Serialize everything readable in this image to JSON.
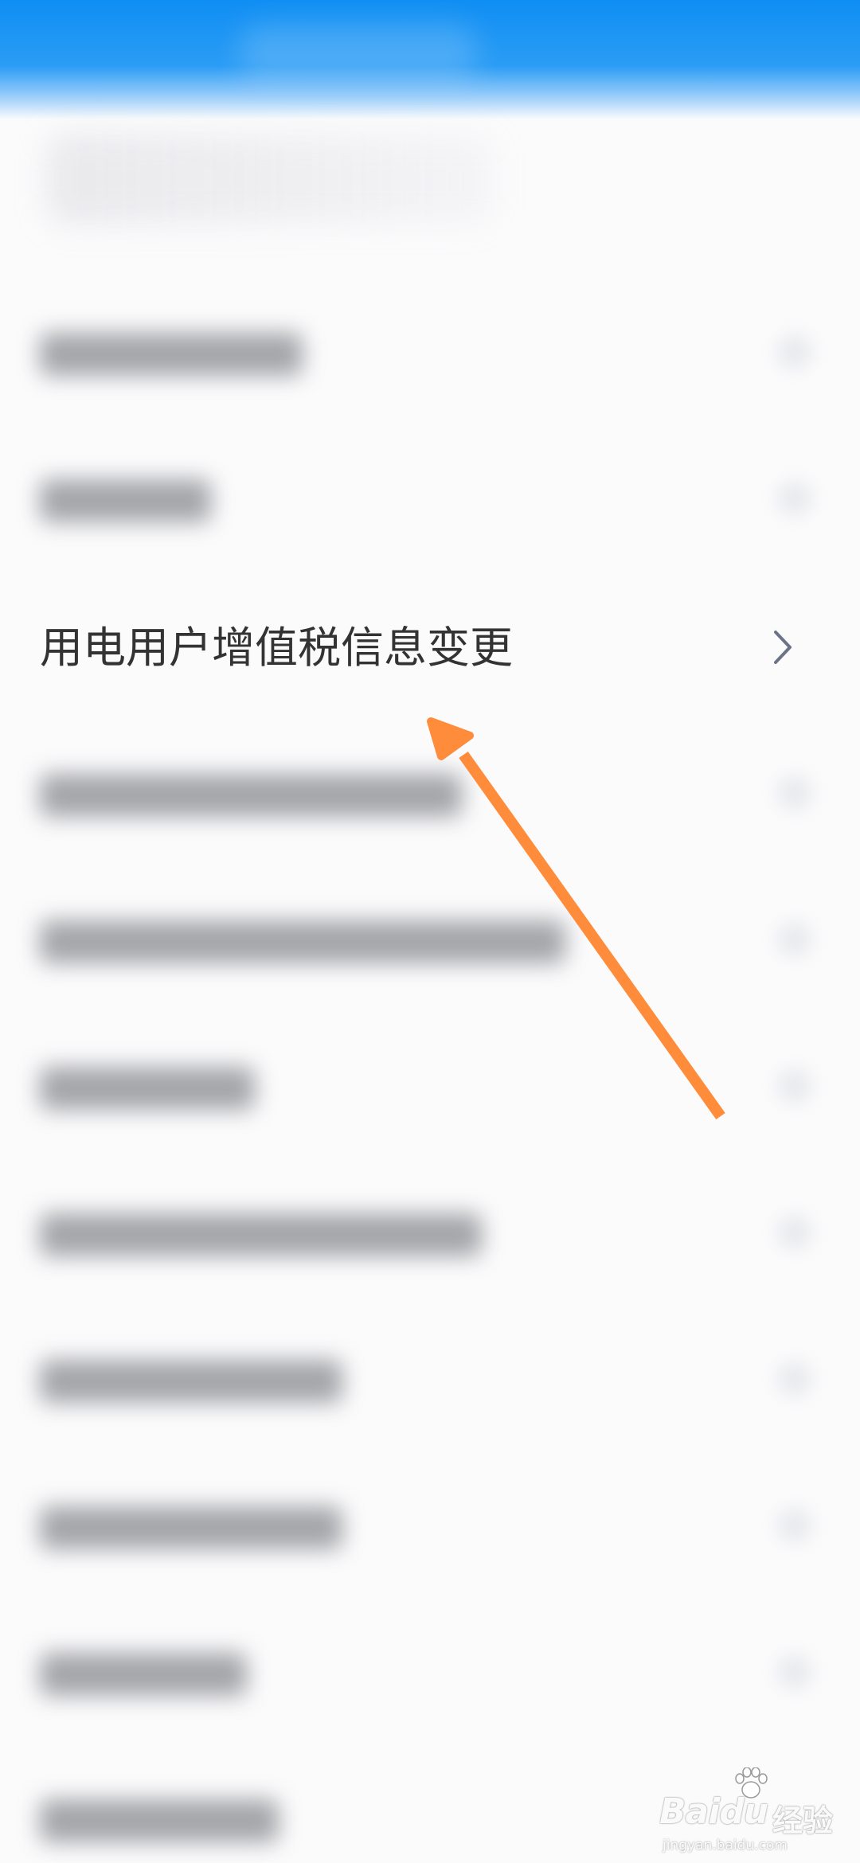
{
  "header": {
    "background_color": "#0f8ef3"
  },
  "list": {
    "focused_item": {
      "label": "用电用户增值税信息变更",
      "chevron_icon": "chevron-right-icon"
    }
  },
  "annotation": {
    "arrow_color": "#ff8c3a",
    "arrow_icon": "arrow-pointer-icon"
  },
  "watermark": {
    "brand": "Baidu",
    "cn": "经验",
    "url": "jingyan.baidu.com"
  }
}
